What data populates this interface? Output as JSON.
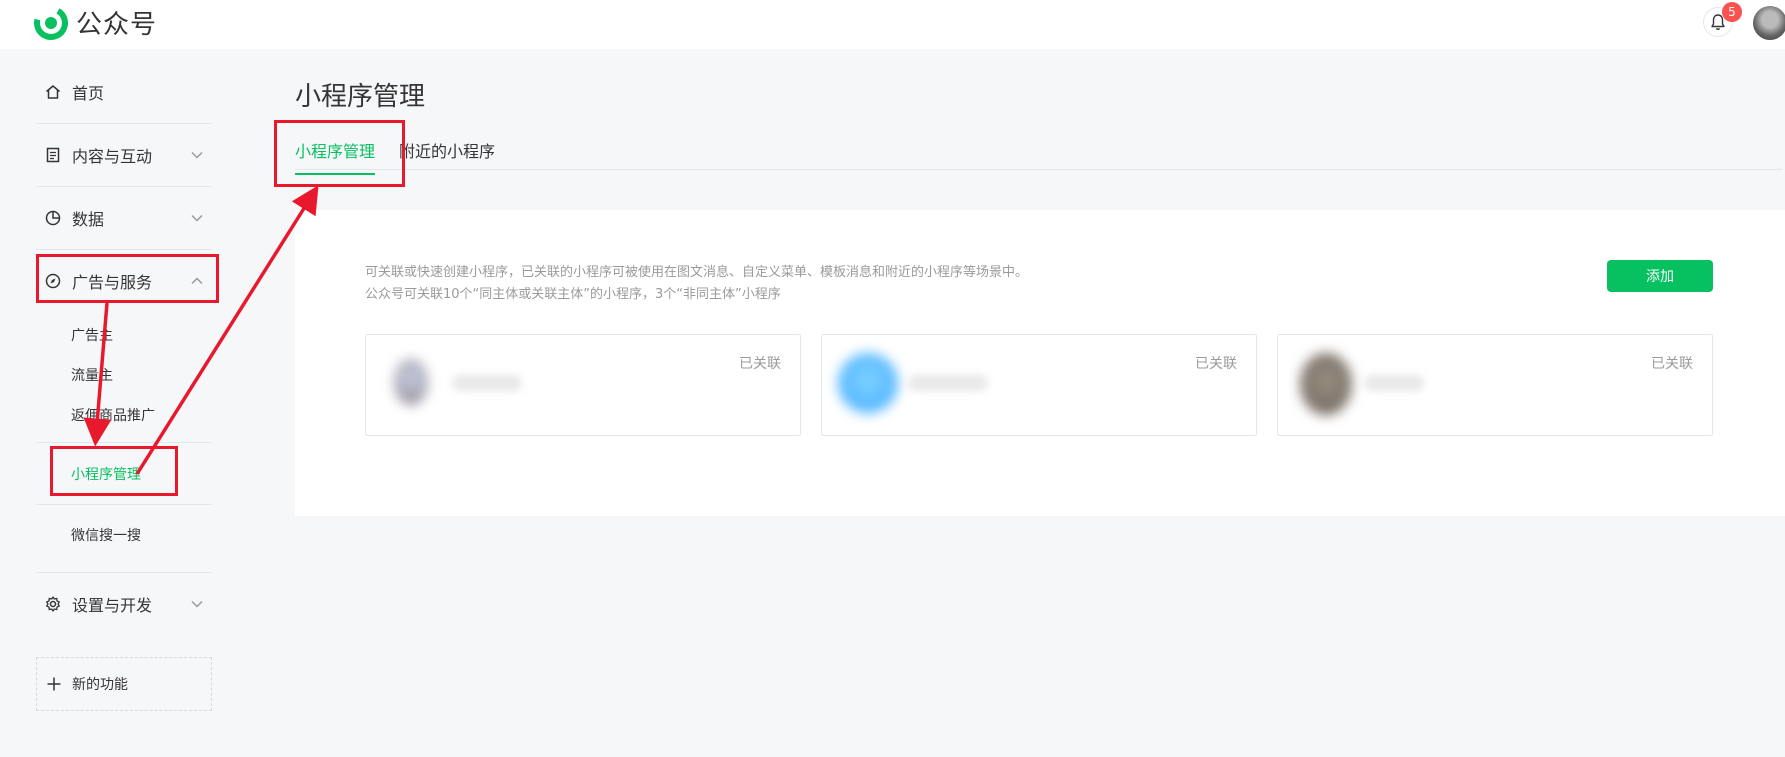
{
  "header": {
    "app_name": "公众号",
    "notification_count": "5",
    "colors": {
      "brand": "#07c160",
      "badge": "#fa5151"
    }
  },
  "sidebar": {
    "home": "首页",
    "content": "内容与互动",
    "data": "数据",
    "ads": "广告与服务",
    "ads_sub": [
      "广告主",
      "流量主",
      "返佣商品推广",
      "小程序管理",
      "微信搜一搜"
    ],
    "settings": "设置与开发",
    "new_feature": "新的功能"
  },
  "main": {
    "title": "小程序管理",
    "tabs": [
      {
        "label": "小程序管理",
        "active": true
      },
      {
        "label": "附近的小程序",
        "active": false
      }
    ],
    "description_line1": "可关联或快速创建小程序，已关联的小程序可被使用在图文消息、自定义菜单、模板消息和附近的小程序等场景中。",
    "description_line2": "公众号可关联10个“同主体或关联主体”的小程序，3个“非同主体”小程序",
    "add_button": "添加",
    "cards": [
      {
        "status": "已关联"
      },
      {
        "status": "已关联"
      },
      {
        "status": "已关联"
      }
    ]
  }
}
